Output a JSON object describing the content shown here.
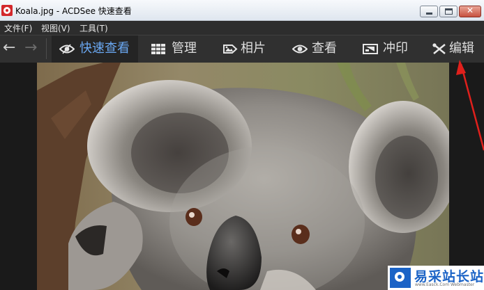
{
  "window": {
    "title": "Koala.jpg - ACDSee 快速查看",
    "app_icon": "acdsee-app-icon",
    "controls": {
      "minimize_icon": "minimize-icon",
      "maximize_icon": "maximize-icon",
      "close_glyph": "✕"
    }
  },
  "menu": {
    "items": [
      {
        "label": "文件(F)"
      },
      {
        "label": "视图(V)"
      },
      {
        "label": "工具(T)"
      }
    ]
  },
  "toolbar": {
    "back_glyph": "←",
    "forward_glyph": "→",
    "tabs": [
      {
        "label": "快速查看",
        "icon": "eye-icon",
        "active": true
      },
      {
        "label": "管理",
        "icon": "grid-icon",
        "active": false
      },
      {
        "label": "相片",
        "icon": "photo-tag-icon",
        "active": false
      },
      {
        "label": "查看",
        "icon": "eye-icon",
        "active": false
      },
      {
        "label": "冲印",
        "icon": "develop-icon",
        "active": false
      },
      {
        "label": "编辑",
        "icon": "edit-tools-icon",
        "active": false
      }
    ]
  },
  "viewer": {
    "image_subject": "koala-photo"
  },
  "watermark": {
    "text": "易采站长站",
    "url": "www.Easck.Com Webmaster"
  },
  "annotation": {
    "color": "#e0201c"
  },
  "colors": {
    "active_tab_text": "#6aa8f2",
    "toolbar_bg": "#303030",
    "menubar_bg": "#2d2d2d"
  }
}
